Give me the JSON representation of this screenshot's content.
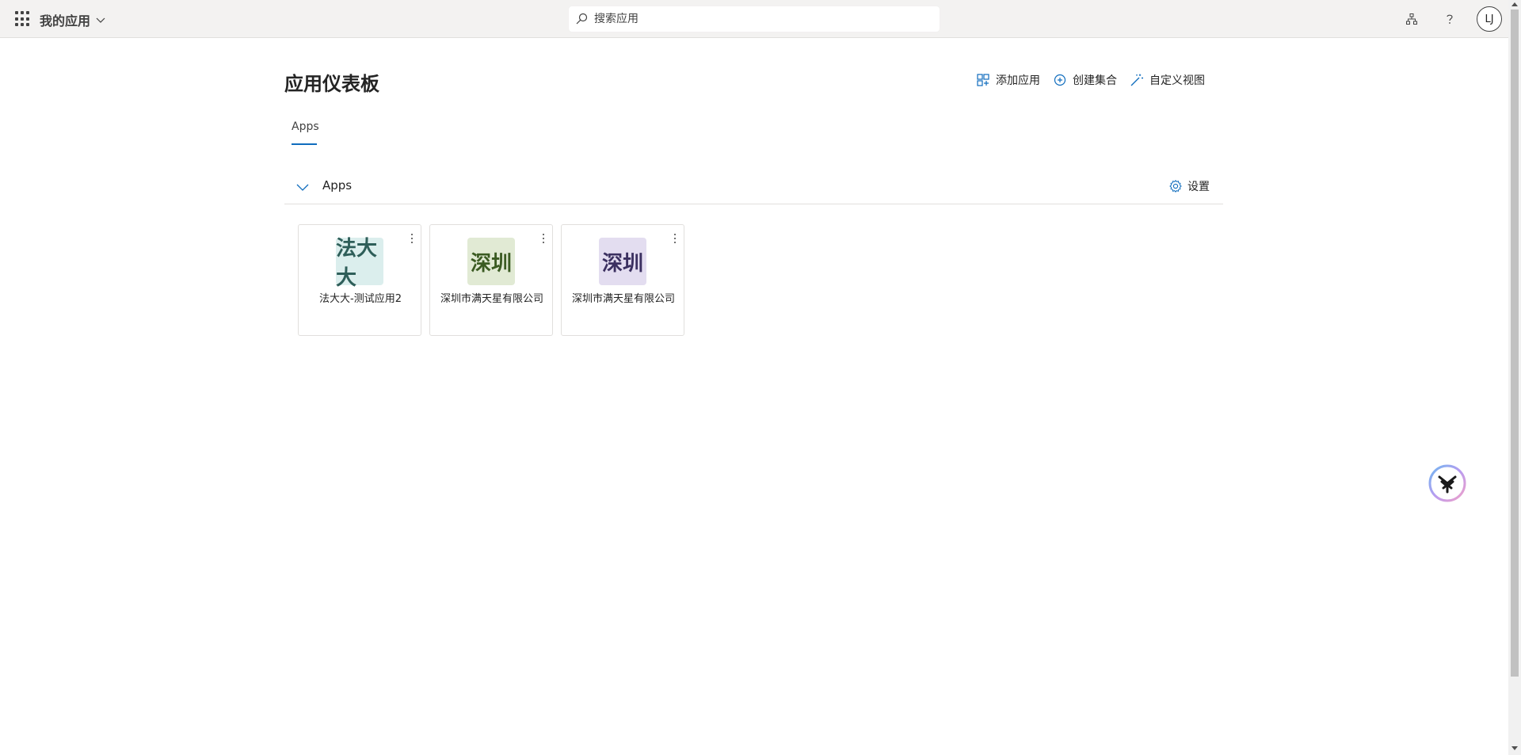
{
  "header": {
    "app_title": "我的应用",
    "search_placeholder": "搜索应用",
    "avatar_initials": "LJ"
  },
  "page": {
    "title": "应用仪表板",
    "actions": {
      "add_app": "添加应用",
      "create_collection": "创建集合",
      "customize_view": "自定义视图"
    },
    "tabs": [
      {
        "label": "Apps",
        "selected": true
      }
    ]
  },
  "section": {
    "title": "Apps",
    "settings_label": "设置"
  },
  "apps": [
    {
      "name": "法大大-测试应用2",
      "logo_text": "法大大",
      "logo_bg": "#dbeeed",
      "logo_color": "#2e5e59"
    },
    {
      "name": "深圳市满天星有限公司",
      "logo_text": "深圳",
      "logo_bg": "#e1ead4",
      "logo_color": "#3b5b22"
    },
    {
      "name": "深圳市满天星有限公司",
      "logo_text": "深圳",
      "logo_bg": "#e3ddf0",
      "logo_color": "#3b3060"
    }
  ],
  "colors": {
    "accent": "#0f6cbd",
    "header_bg": "#f3f2f1"
  },
  "icons": {
    "waffle": "app-launcher-icon",
    "search": "search-icon",
    "org": "org-chart-icon",
    "help": "help-icon",
    "add": "add-app-icon",
    "create": "add-circle-icon",
    "customize": "magic-wand-icon",
    "settings": "gear-icon",
    "bot": "assistant-bot-icon"
  }
}
